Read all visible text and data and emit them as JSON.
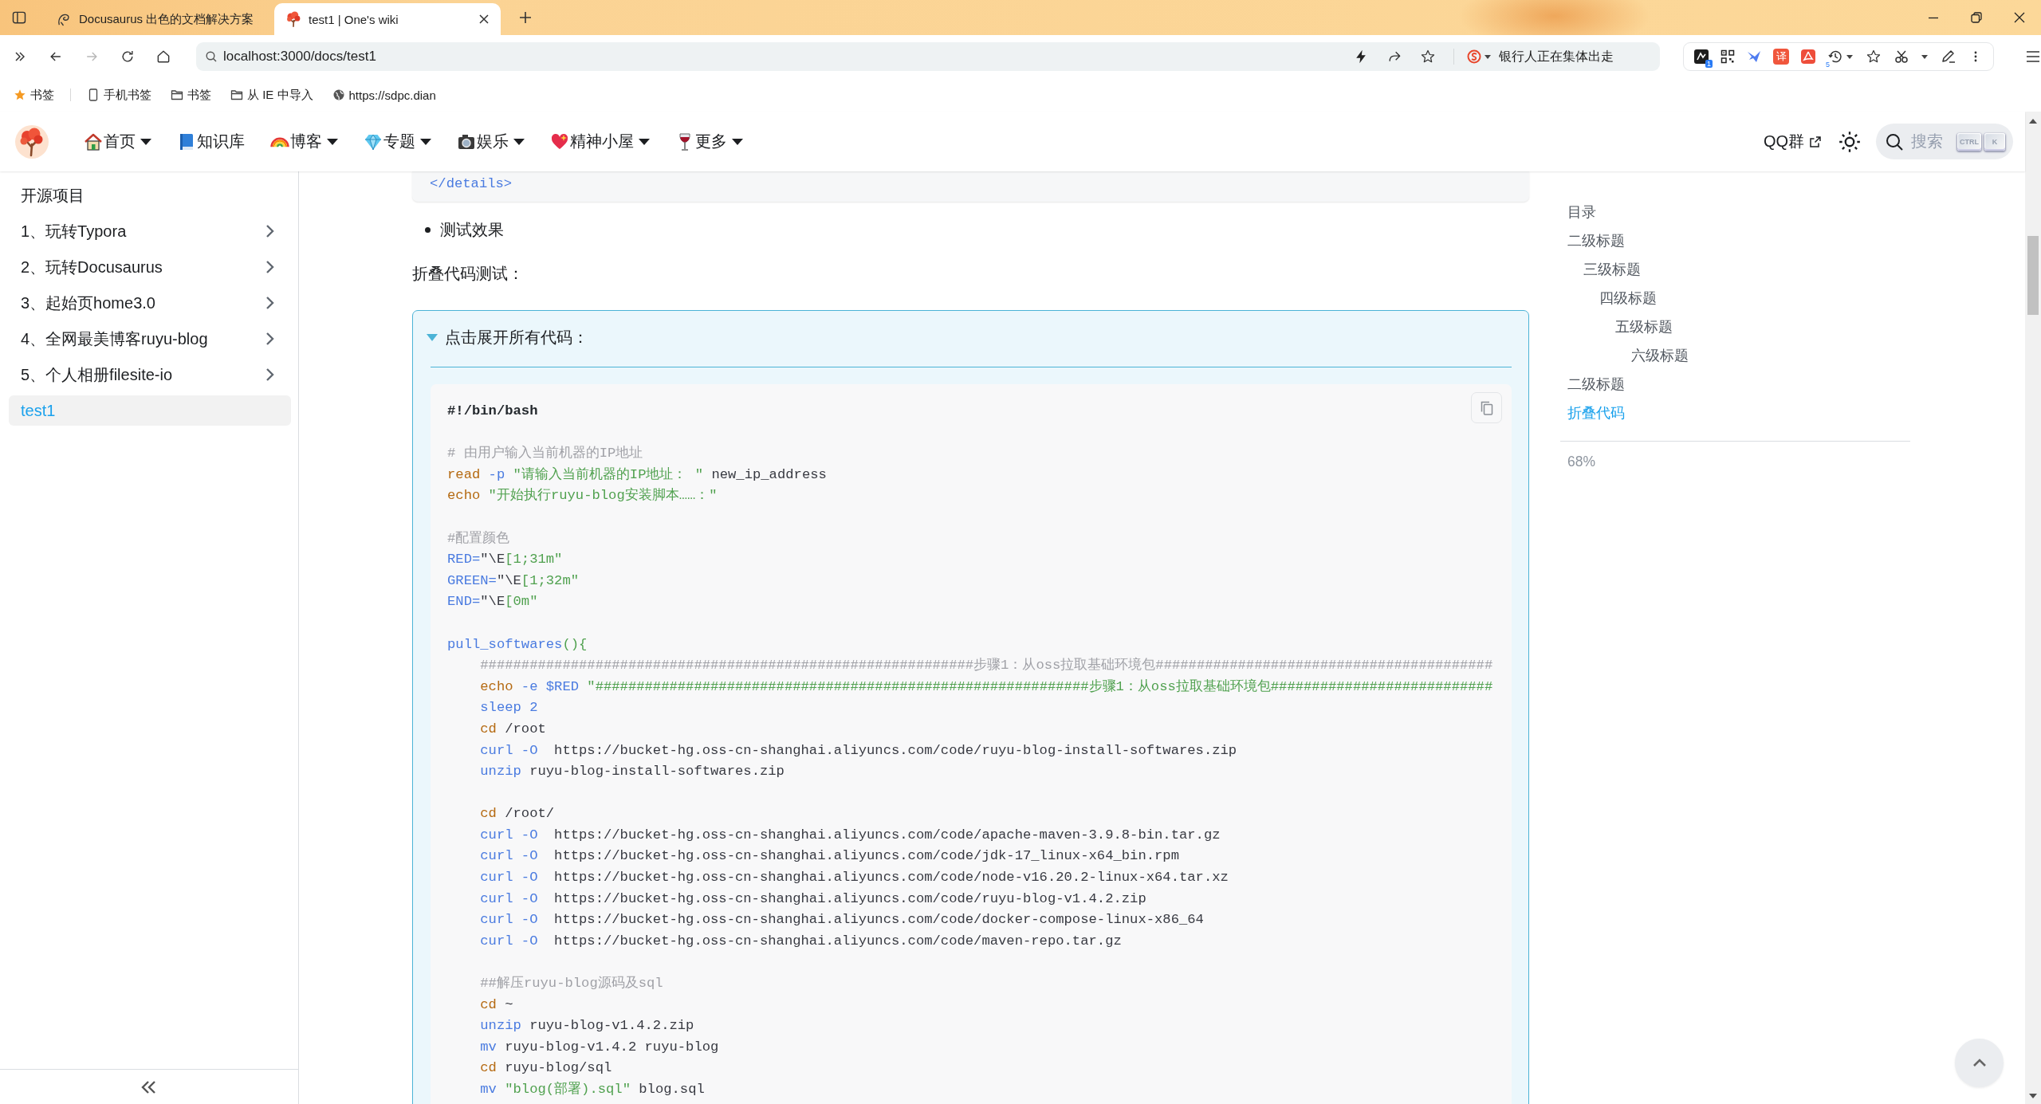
{
  "browser": {
    "tabs": [
      {
        "title": "Docusaurus 出色的文档解决方案",
        "selected": false
      },
      {
        "title": "test1 | One's wiki",
        "selected": true
      }
    ],
    "forward_disabled": true,
    "address": "localhost:3000/docs/test1",
    "hot_search": "银行人正在集体出走",
    "extension_badge": "1",
    "translate_label": "译",
    "history_badge": "5"
  },
  "bookmarks": {
    "menu": "书签",
    "items": [
      {
        "label": "手机书签",
        "kind": "mobile"
      },
      {
        "label": "书签",
        "kind": "folder"
      },
      {
        "label": "从 IE 中导入",
        "kind": "folder"
      },
      {
        "label": "https://sdpc.dian",
        "kind": "link"
      }
    ]
  },
  "navbar": {
    "items": [
      {
        "label": "首页",
        "dropdown": true
      },
      {
        "label": "知识库",
        "dropdown": false
      },
      {
        "label": "博客",
        "dropdown": true
      },
      {
        "label": "专题",
        "dropdown": true
      },
      {
        "label": "娱乐",
        "dropdown": true
      },
      {
        "label": "精神小屋",
        "dropdown": true
      },
      {
        "label": "更多",
        "dropdown": true
      }
    ],
    "qq_link": "QQ群",
    "search": {
      "label": "搜索",
      "keys": [
        "CTRL",
        "K"
      ]
    }
  },
  "sidebar": {
    "items": [
      {
        "label": "开源项目",
        "kind": "link",
        "selected": false
      },
      {
        "label": "1、玩转Typora",
        "kind": "category",
        "expanded": false,
        "selected": false
      },
      {
        "label": "2、玩转Docusaurus",
        "kind": "category",
        "expanded": false,
        "selected": false
      },
      {
        "label": "3、起始页home3.0",
        "kind": "category",
        "expanded": false,
        "selected": false
      },
      {
        "label": "4、全网最美博客ruyu-blog",
        "kind": "category",
        "expanded": false,
        "selected": false
      },
      {
        "label": "5、个人相册filesite-io",
        "kind": "category",
        "expanded": false,
        "selected": false
      },
      {
        "label": "test1",
        "kind": "link",
        "selected": true
      }
    ]
  },
  "content": {
    "code_tail": [
      {
        "kind": "tag",
        "text": "</details>"
      }
    ],
    "bullets": [
      "测试效果"
    ],
    "paragraph": "折叠代码测试：",
    "details": {
      "summary": "点击展开所有代码：",
      "open": true,
      "code": [
        [
          {
            "tokens": [
              {
                "kind": "shebang",
                "text": "#!/bin/bash"
              }
            ]
          }
        ],
        [
          {
            "tokens": [
              {
                "kind": "comment",
                "text": "# 由用户输入当前机器的IP地址"
              }
            ]
          },
          {
            "tokens": [
              {
                "kind": "keyword",
                "text": "read"
              },
              {
                "kind": "builtin",
                "text": " -p"
              },
              {
                "kind": "string",
                "text": " \"请输入当前机器的IP地址： \""
              },
              {
                "kind": "plain",
                "text": " new_ip_address"
              }
            ]
          },
          {
            "tokens": [
              {
                "kind": "keyword",
                "text": "echo"
              },
              {
                "kind": "string",
                "text": " \"开始执行ruyu-blog安装脚本……：\""
              }
            ]
          }
        ],
        [
          {
            "tokens": [
              {
                "kind": "comment",
                "text": "#配置颜色"
              }
            ]
          },
          {
            "tokens": [
              {
                "kind": "variable",
                "text": "RED="
              },
              {
                "kind": "plain",
                "text": "\"\\E"
              },
              {
                "kind": "string",
                "text": "[1;31m\""
              }
            ]
          },
          {
            "tokens": [
              {
                "kind": "variable",
                "text": "GREEN="
              },
              {
                "kind": "plain",
                "text": "\"\\E"
              },
              {
                "kind": "string",
                "text": "[1;32m\""
              }
            ]
          },
          {
            "tokens": [
              {
                "kind": "variable",
                "text": "END="
              },
              {
                "kind": "plain",
                "text": "\"\\E"
              },
              {
                "kind": "string",
                "text": "[0m\""
              }
            ]
          }
        ],
        [
          {
            "tokens": [
              {
                "kind": "function",
                "text": "pull_softwares"
              },
              {
                "kind": "punctuation",
                "text": "(){"
              }
            ],
            "children": [
              [
                {
                  "tokens": [
                    {
                      "kind": "comment",
                      "text": "############################################################步骤1：从oss拉取基础环境包#########################################"
                    }
                  ]
                },
                {
                  "tokens": [
                    {
                      "kind": "keyword",
                      "text": "echo"
                    },
                    {
                      "kind": "builtin",
                      "text": " -e $RED"
                    },
                    {
                      "kind": "string",
                      "text": " \"############################################################步骤1：从oss拉取基础环境包###########################"
                    }
                  ]
                },
                {
                  "tokens": [
                    {
                      "kind": "builtin",
                      "text": "sleep 2"
                    }
                  ]
                },
                {
                  "tokens": [
                    {
                      "kind": "keyword",
                      "text": "cd"
                    },
                    {
                      "kind": "plain",
                      "text": " /root"
                    }
                  ]
                },
                {
                  "tokens": [
                    {
                      "kind": "builtin",
                      "text": "curl -O"
                    },
                    {
                      "kind": "plain",
                      "text": "  https://bucket-hg.oss-cn-shanghai.aliyuncs.com/code/ruyu-blog-install-softwares.zip"
                    }
                  ]
                },
                {
                  "tokens": [
                    {
                      "kind": "builtin",
                      "text": "unzip"
                    },
                    {
                      "kind": "plain",
                      "text": " ruyu-blog-install-softwares.zip"
                    }
                  ]
                }
              ],
              [
                {
                  "tokens": [
                    {
                      "kind": "keyword",
                      "text": "cd"
                    },
                    {
                      "kind": "plain",
                      "text": " /root/"
                    }
                  ]
                },
                {
                  "tokens": [
                    {
                      "kind": "builtin",
                      "text": "curl -O"
                    },
                    {
                      "kind": "plain",
                      "text": "  https://bucket-hg.oss-cn-shanghai.aliyuncs.com/code/apache-maven-3.9.8-bin.tar.gz"
                    }
                  ]
                },
                {
                  "tokens": [
                    {
                      "kind": "builtin",
                      "text": "curl -O"
                    },
                    {
                      "kind": "plain",
                      "text": "  https://bucket-hg.oss-cn-shanghai.aliyuncs.com/code/jdk-17_linux-x64_bin.rpm"
                    }
                  ]
                },
                {
                  "tokens": [
                    {
                      "kind": "builtin",
                      "text": "curl -O"
                    },
                    {
                      "kind": "plain",
                      "text": "  https://bucket-hg.oss-cn-shanghai.aliyuncs.com/code/node-v16.20.2-linux-x64.tar.xz"
                    }
                  ]
                },
                {
                  "tokens": [
                    {
                      "kind": "builtin",
                      "text": "curl -O"
                    },
                    {
                      "kind": "plain",
                      "text": "  https://bucket-hg.oss-cn-shanghai.aliyuncs.com/code/ruyu-blog-v1.4.2.zip"
                    }
                  ]
                },
                {
                  "tokens": [
                    {
                      "kind": "builtin",
                      "text": "curl -O"
                    },
                    {
                      "kind": "plain",
                      "text": "  https://bucket-hg.oss-cn-shanghai.aliyuncs.com/code/docker-compose-linux-x86_64"
                    }
                  ]
                },
                {
                  "tokens": [
                    {
                      "kind": "builtin",
                      "text": "curl -O"
                    },
                    {
                      "kind": "plain",
                      "text": "  https://bucket-hg.oss-cn-shanghai.aliyuncs.com/code/maven-repo.tar.gz"
                    }
                  ]
                }
              ],
              [
                {
                  "tokens": [
                    {
                      "kind": "comment",
                      "text": "##解压ruyu-blog源码及sql"
                    }
                  ]
                },
                {
                  "tokens": [
                    {
                      "kind": "keyword",
                      "text": "cd"
                    },
                    {
                      "kind": "plain",
                      "text": " ~"
                    }
                  ]
                },
                {
                  "tokens": [
                    {
                      "kind": "builtin",
                      "text": "unzip"
                    },
                    {
                      "kind": "plain",
                      "text": " ruyu-blog-v1.4.2.zip"
                    }
                  ]
                },
                {
                  "tokens": [
                    {
                      "kind": "builtin",
                      "text": "mv"
                    },
                    {
                      "kind": "plain",
                      "text": " ruyu-blog-v1.4.2 ruyu-blog"
                    }
                  ]
                },
                {
                  "tokens": [
                    {
                      "kind": "keyword",
                      "text": "cd"
                    },
                    {
                      "kind": "plain",
                      "text": " ruyu-blog/sql"
                    }
                  ]
                },
                {
                  "tokens": [
                    {
                      "kind": "builtin",
                      "text": "mv"
                    },
                    {
                      "kind": "string",
                      "text": " \"blog(部署).sql\""
                    },
                    {
                      "kind": "plain",
                      "text": " blog.sql"
                    }
                  ]
                }
              ]
            ]
          }
        ]
      ]
    }
  },
  "toc": {
    "items": [
      {
        "label": "目录",
        "selected": false
      },
      {
        "label": "二级标题",
        "selected": false,
        "children": [
          {
            "label": "三级标题",
            "selected": false,
            "children": [
              {
                "label": "四级标题",
                "selected": false,
                "children": [
                  {
                    "label": "五级标题",
                    "selected": false,
                    "children": [
                      {
                        "label": "六级标题",
                        "selected": false
                      }
                    ]
                  }
                ]
              }
            ]
          }
        ]
      },
      {
        "label": "二级标题",
        "selected": false
      },
      {
        "label": "折叠代码",
        "selected": true
      }
    ],
    "progress": "68%"
  }
}
